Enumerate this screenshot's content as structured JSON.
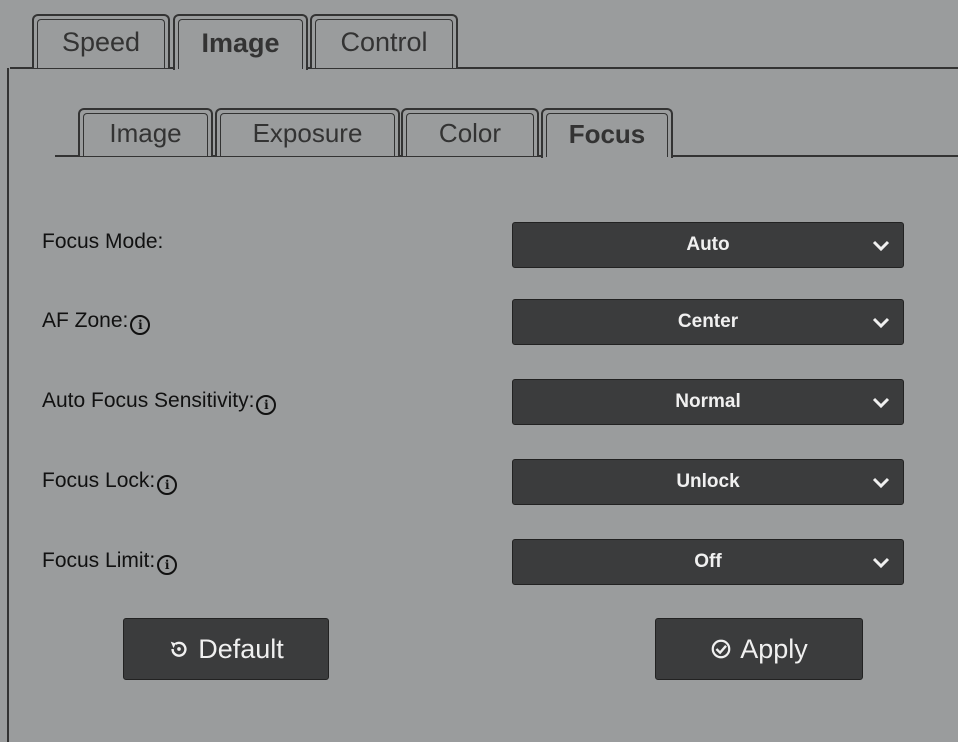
{
  "top_tabs": [
    "Speed",
    "Image",
    "Control"
  ],
  "top_active": "Image",
  "sub_tabs": [
    "Image",
    "Exposure",
    "Color",
    "Focus"
  ],
  "sub_active": "Focus",
  "settings": [
    {
      "label": "Focus Mode:",
      "info": false,
      "value": "Auto"
    },
    {
      "label": "AF Zone:",
      "info": true,
      "value": "Center"
    },
    {
      "label": "Auto Focus Sensitivity:",
      "info": true,
      "value": "Normal"
    },
    {
      "label": "Focus Lock:",
      "info": true,
      "value": "Unlock"
    },
    {
      "label": "Focus Limit:",
      "info": true,
      "value": "Off"
    }
  ],
  "buttons": {
    "default_label": "Default",
    "apply_label": "Apply"
  },
  "icons": {
    "info": "info-circle-icon",
    "chevron": "chevron-down-icon",
    "reset": "reset-icon",
    "check": "check-circle-icon"
  },
  "colors": {
    "background": "#9a9c9d",
    "control": "#3b3c3d",
    "control_text": "#f0f0f0"
  }
}
